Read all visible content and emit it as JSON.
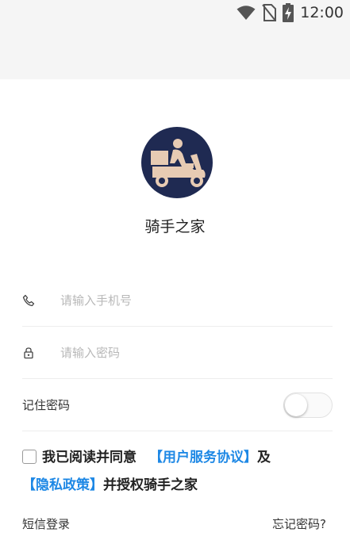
{
  "status_bar": {
    "time": "12:00",
    "icons": [
      "wifi-icon",
      "no-sim-icon",
      "battery-charging-icon"
    ]
  },
  "app": {
    "name": "骑手之家",
    "logo_icon": "delivery-scooter-icon"
  },
  "form": {
    "phone_placeholder": "请输入手机号",
    "phone_value": "",
    "password_placeholder": "请输入密码",
    "password_value": "",
    "remember_label": "记住密码",
    "remember_on": false
  },
  "agreement": {
    "checked": false,
    "prefix": "我已阅读并同意",
    "user_agreement": "【用户服务协议】",
    "and": "及",
    "privacy_policy": "【隐私政策】",
    "suffix": "并授权骑手之家"
  },
  "footer": {
    "sms_login": "短信登录",
    "forgot_password": "忘记密码?"
  },
  "colors": {
    "link": "#1e88e5",
    "logo_bg": "#1f2a52",
    "logo_figure": "#e7cbb3",
    "status_bg": "#f5f5f5"
  }
}
